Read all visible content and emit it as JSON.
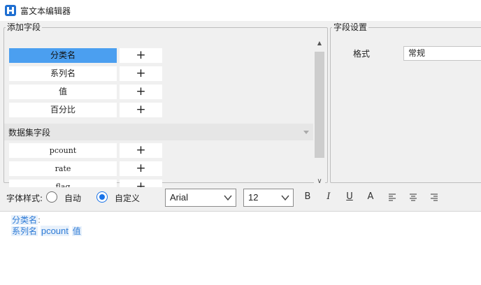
{
  "window": {
    "title": "富文本编辑器"
  },
  "add_fields": {
    "title": "添加字段",
    "fields": [
      {
        "label": "分类名",
        "selected": true
      },
      {
        "label": "系列名",
        "selected": false
      },
      {
        "label": "值",
        "selected": false
      },
      {
        "label": "百分比",
        "selected": false
      }
    ],
    "dataset_section": {
      "title": "数据集字段"
    },
    "dataset_fields": [
      {
        "label": "pcount"
      },
      {
        "label": "rate"
      },
      {
        "label": "flag"
      }
    ],
    "add_symbol": "+",
    "scroll_up": "▲",
    "scroll_down": "∨"
  },
  "field_settings": {
    "title": "字段设置",
    "format_label": "格式",
    "format_value": "常规"
  },
  "toolbar": {
    "font_style_label": "字体样式:",
    "mode_auto": "自动",
    "mode_custom": "自定义",
    "selected_mode": "custom",
    "font_family": "Arial",
    "font_size": "12",
    "bold": "B",
    "italic": "I",
    "underline": "U",
    "font_color": "A"
  },
  "editor": {
    "line1": {
      "tag": "分类名",
      "suffix": ":"
    },
    "line2": {
      "tags": [
        "系列名",
        "pcount",
        "值"
      ]
    }
  },
  "colors": {
    "selection": "#4b9ff0",
    "accent": "#1a73e8",
    "tag_text": "#2e7bd6",
    "logo": "#1f6fd1"
  }
}
